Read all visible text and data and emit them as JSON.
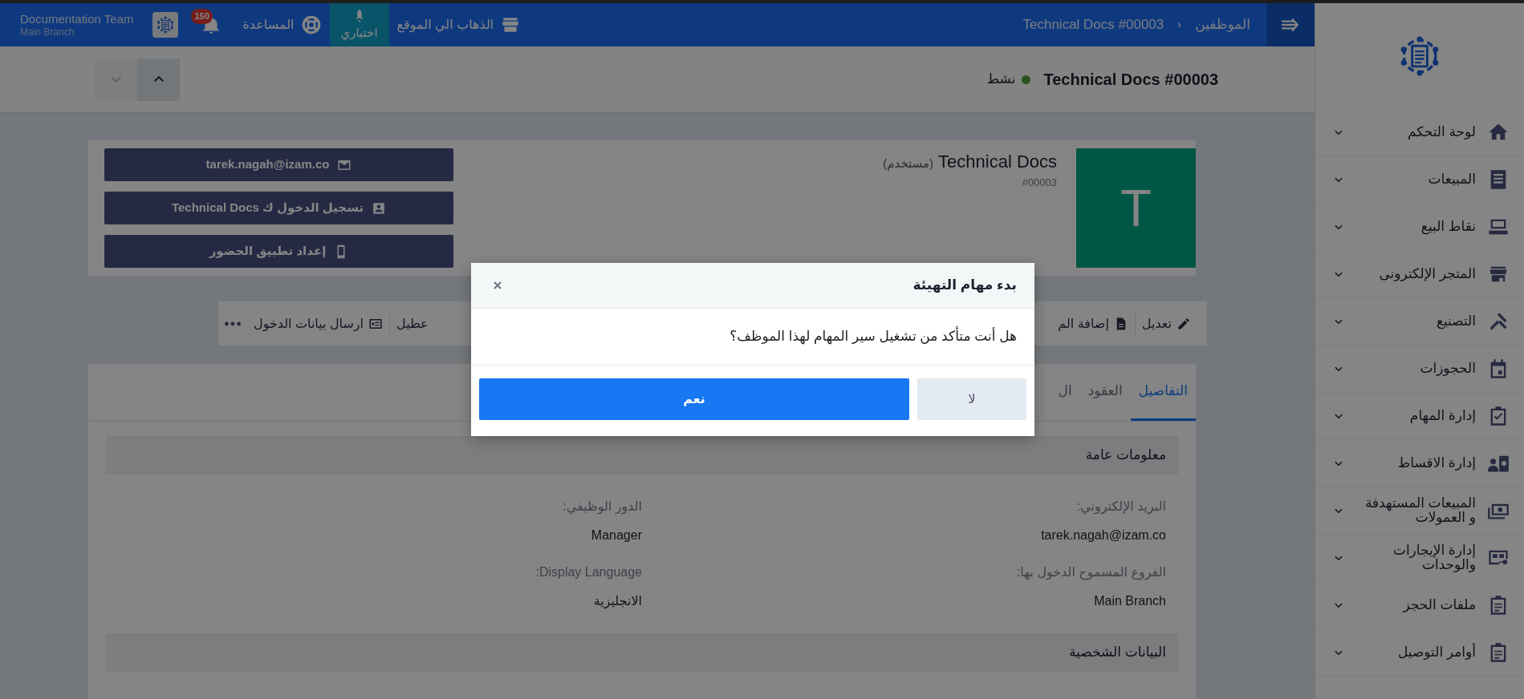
{
  "sidebar": {
    "items": [
      {
        "label": "لوحة التحكم"
      },
      {
        "label": "المبيعات"
      },
      {
        "label": "نقاط البيع"
      },
      {
        "label": "المتجر الإلكترونى"
      },
      {
        "label": "التصنيع"
      },
      {
        "label": "الحجوزات"
      },
      {
        "label": "إدارة المهام"
      },
      {
        "label": "إدارة الاقساط"
      },
      {
        "label": "المبيعات المستهدفة و العمولات"
      },
      {
        "label": "إدارة الإيجارات والوحدات"
      },
      {
        "label": "ملفات الحجز"
      },
      {
        "label": "أوامر التوصيل"
      }
    ]
  },
  "topbar": {
    "breadcrumbs": [
      "الموظفين",
      "Technical Docs #00003"
    ],
    "links": [
      {
        "label": "الذهاب الي الموقع",
        "kind": "site",
        "selected": false
      },
      {
        "label": "اختباري",
        "kind": "test",
        "selected": true
      },
      {
        "label": "المساعدة",
        "kind": "help",
        "selected": false
      }
    ],
    "notifications": "150",
    "user": {
      "name": "Documentation Team",
      "branch": "Main Branch"
    }
  },
  "header": {
    "title": "Technical Docs #00003",
    "status": {
      "label": "نشط",
      "kind": "active"
    },
    "nav_buttons": [
      {
        "kind": "up",
        "disabled": false
      },
      {
        "kind": "down",
        "disabled": true
      }
    ]
  },
  "profile": {
    "avatar_letter": "T",
    "name": "Technical Docs",
    "role": "(مستخدم)",
    "code": "#00003",
    "actions": [
      {
        "label": "tarek.nagah@izam.co"
      },
      {
        "label": "تسجيل الدخول ك Technical Docs"
      },
      {
        "label": "إعداد تطبيق الحضور"
      }
    ]
  },
  "toolbar": {
    "items": [
      {
        "label": "تعديل"
      },
      {
        "label": "إضافة الم"
      },
      {
        "label": "عطيل"
      },
      {
        "label": "ارسال بيانات الدخول"
      }
    ]
  },
  "tabs": [
    {
      "label": "التفاصيل",
      "selected": true
    },
    {
      "label": "العقود",
      "selected": false
    },
    {
      "label": "ال",
      "selected": false
    }
  ],
  "sections": [
    {
      "title": "معلومات عامة",
      "fields": [
        {
          "label": "البريد الإلكتروني:",
          "value": "tarek.nagah@izam.co"
        },
        {
          "label": "الدور الوظيفي:",
          "value": "Manager"
        },
        {
          "label": "الفروع المسموح الدخول بها:",
          "value": "Main Branch"
        },
        {
          "label": "Display Language:",
          "value": "الانجليزية"
        }
      ]
    },
    {
      "title": "البيانات الشخصية"
    }
  ],
  "modal": {
    "title": "بدء مهام التهيئة",
    "message": "هل أنت متأكد من تشغيل سير المهام لهذا الموظف؟",
    "buttons": [
      {
        "label": "لا",
        "kind": "secondary"
      },
      {
        "label": "نعم",
        "kind": "primary"
      }
    ]
  }
}
